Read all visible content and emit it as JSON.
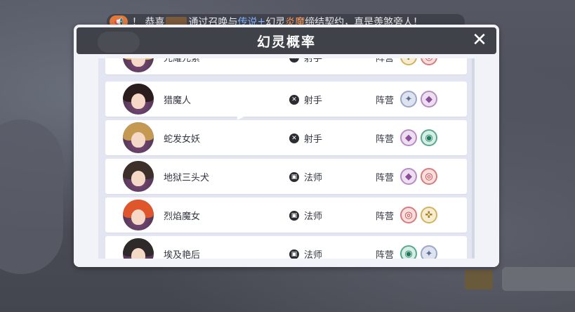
{
  "ticker": {
    "icon": "horn-icon",
    "prefix": "！ 恭喜",
    "middle": "通过召唤与",
    "legend": "传说",
    "plus": "+",
    "spirit": "幻灵",
    "fire": "炎魔",
    "suffix": "缔结契约，真是羡煞旁人！"
  },
  "dialog": {
    "title": "幻灵概率",
    "close_label": "✕"
  },
  "faction_label": "阵营",
  "heroes": [
    {
      "name": "光耀元素",
      "role": "射手",
      "role_icon": "archer-icon",
      "factions": [
        "wing",
        "spiral"
      ],
      "hair_color": "#e2b85a"
    },
    {
      "name": "猎魔人",
      "role": "射手",
      "role_icon": "archer-icon",
      "factions": [
        "star",
        "diamond"
      ],
      "hair_color": "#2b1c1e"
    },
    {
      "name": "蛇发女妖",
      "role": "射手",
      "role_icon": "archer-icon",
      "factions": [
        "diamond",
        "eye"
      ],
      "hair_color": "#c49a52"
    },
    {
      "name": "地狱三头犬",
      "role": "法师",
      "role_icon": "mage-icon",
      "factions": [
        "diamond",
        "spiral"
      ],
      "hair_color": "#3d302a"
    },
    {
      "name": "烈焰魔女",
      "role": "法师",
      "role_icon": "mage-icon",
      "factions": [
        "spiral",
        "wing"
      ],
      "hair_color": "#e0562c"
    },
    {
      "name": "埃及艳后",
      "role": "法师",
      "role_icon": "mage-icon",
      "factions": [
        "eye",
        "star"
      ],
      "hair_color": "#2f2a2a"
    }
  ],
  "faction_glyphs": {
    "star": "✦",
    "diamond": "◆",
    "spiral": "◎",
    "eye": "◉",
    "wing": "✜"
  }
}
